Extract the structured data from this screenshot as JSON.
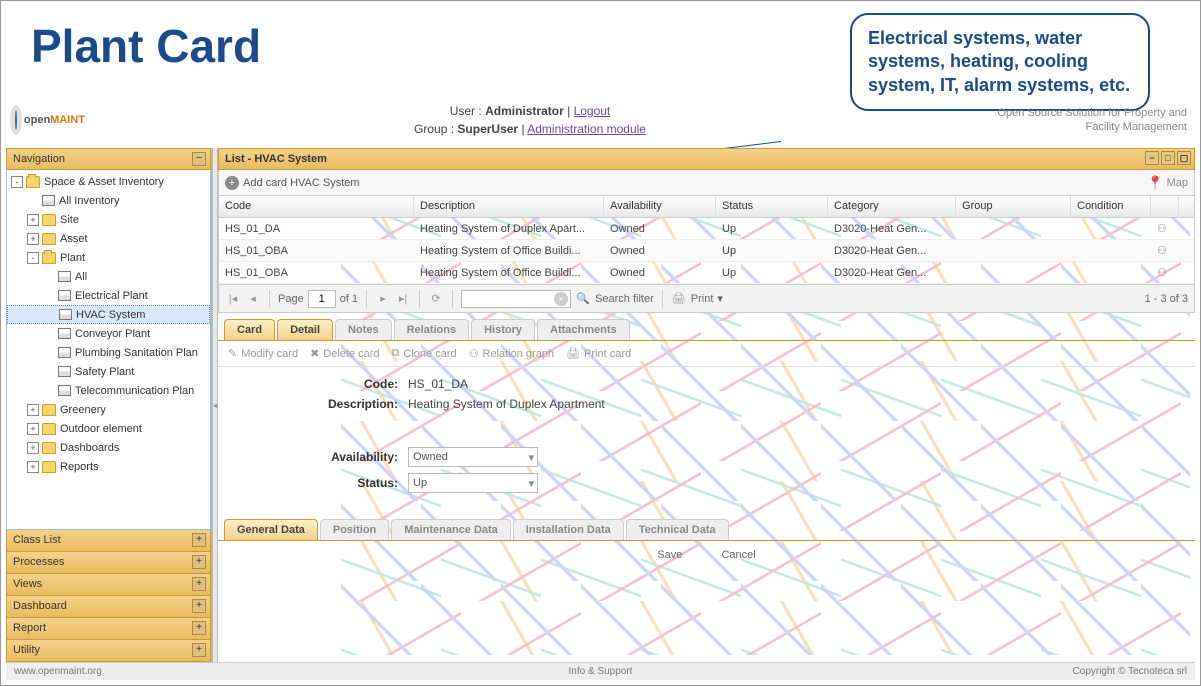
{
  "slide_title": "Plant Card",
  "callout_text": "Electrical systems, water systems, heating, cooling system, IT, alarm systems, etc.",
  "logo": {
    "text_a": "open",
    "text_b": "MAINT"
  },
  "user_bar": {
    "user_label": "User :",
    "user_name": "Administrator",
    "logout": "Logout",
    "group_label": "Group :",
    "group_name": "SuperUser",
    "admin_link": "Administration module"
  },
  "tagline": "Open Source Solution for Property and Facility Management",
  "nav": {
    "header": "Navigation",
    "tree": [
      {
        "level": 1,
        "toggle": "-",
        "icon": "folder-open",
        "label": "Space & Asset Inventory"
      },
      {
        "level": 2,
        "toggle": " ",
        "icon": "grid",
        "label": "All Inventory"
      },
      {
        "level": 2,
        "toggle": "+",
        "icon": "folder",
        "label": "Site"
      },
      {
        "level": 2,
        "toggle": "+",
        "icon": "folder",
        "label": "Asset"
      },
      {
        "level": 2,
        "toggle": "-",
        "icon": "folder-open",
        "label": "Plant"
      },
      {
        "level": 3,
        "toggle": " ",
        "icon": "grid",
        "label": "All"
      },
      {
        "level": 3,
        "toggle": " ",
        "icon": "grid",
        "label": "Electrical Plant"
      },
      {
        "level": 3,
        "toggle": " ",
        "icon": "grid",
        "label": "HVAC System",
        "selected": true
      },
      {
        "level": 3,
        "toggle": " ",
        "icon": "grid",
        "label": "Conveyor Plant"
      },
      {
        "level": 3,
        "toggle": " ",
        "icon": "grid",
        "label": "Plumbing Sanitation Plan"
      },
      {
        "level": 3,
        "toggle": " ",
        "icon": "grid",
        "label": "Safety Plant"
      },
      {
        "level": 3,
        "toggle": " ",
        "icon": "grid",
        "label": "Telecommunication Plan"
      },
      {
        "level": 2,
        "toggle": "+",
        "icon": "folder",
        "label": "Greenery"
      },
      {
        "level": 2,
        "toggle": "+",
        "icon": "folder",
        "label": "Outdoor element"
      },
      {
        "level": 2,
        "toggle": "+",
        "icon": "folder",
        "label": "Dashboards"
      },
      {
        "level": 2,
        "toggle": "+",
        "icon": "folder",
        "label": "Reports"
      }
    ],
    "accordion": [
      "Class List",
      "Processes",
      "Views",
      "Dashboard",
      "Report",
      "Utility"
    ]
  },
  "list": {
    "header": "List - HVAC System",
    "add_card": "Add card HVAC System",
    "map": "Map",
    "columns": [
      "Code",
      "Description",
      "Availability",
      "Status",
      "Category",
      "Group",
      "Condition"
    ],
    "rows": [
      {
        "code": "HS_01_DA",
        "desc": "Heating System of Duplex Apart...",
        "avail": "Owned",
        "status": "Up",
        "cat": "D3020-Heat Gen...",
        "group": "",
        "cond": ""
      },
      {
        "code": "HS_01_OBA",
        "desc": "Heating System of Office Buildi...",
        "avail": "Owned",
        "status": "Up",
        "cat": "D3020-Heat Gen...",
        "group": "",
        "cond": ""
      },
      {
        "code": "HS_01_OBA",
        "desc": "Heating System of Office Buildi...",
        "avail": "Owned",
        "status": "Up",
        "cat": "D3020-Heat Gen...",
        "group": "",
        "cond": ""
      }
    ]
  },
  "pager": {
    "page_label": "Page",
    "page_current": "1",
    "of_label": "of 1",
    "search_ph": "Search filter",
    "print": "Print",
    "count": "1 - 3 of 3"
  },
  "card_tabs": [
    "Card",
    "Detail",
    "Notes",
    "Relations",
    "History",
    "Attachments"
  ],
  "card_toolbar": {
    "modify": "Modify card",
    "delete": "Delete card",
    "clone": "Clone card",
    "graph": "Relation graph",
    "print": "Print card"
  },
  "card": {
    "code_label": "Code:",
    "code_value": "HS_01_DA",
    "desc_label": "Description:",
    "desc_value": "Heating System of Duplex Apartment",
    "avail_label": "Availability:",
    "avail_value": "Owned",
    "status_label": "Status:",
    "status_value": "Up"
  },
  "subtabs": [
    "General Data",
    "Position",
    "Maintenance Data",
    "Installation Data",
    "Technical Data"
  ],
  "buttons": {
    "save": "Save",
    "cancel": "Cancel"
  },
  "footer": {
    "left": "www.openmaint.org",
    "center": "Info & Support",
    "right": "Copyright © Tecnoteca srl"
  }
}
